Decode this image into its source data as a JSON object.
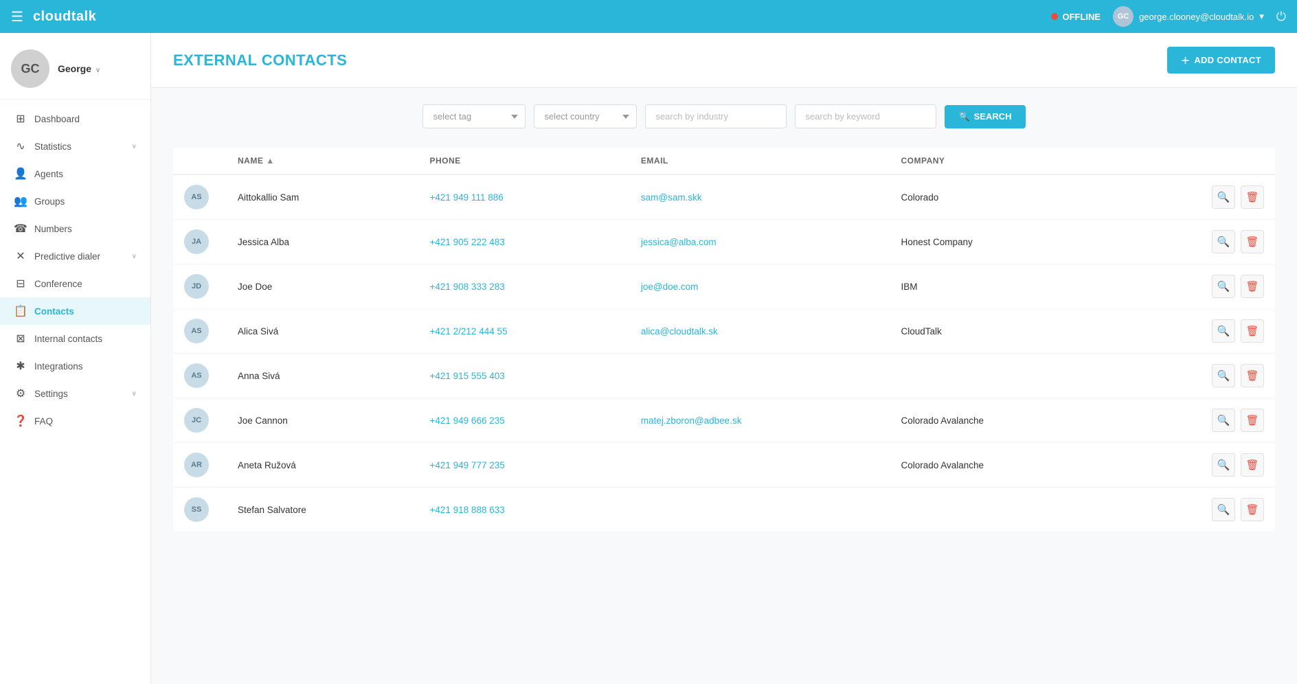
{
  "app": {
    "name": "cloudtalk",
    "menu_icon": "☰"
  },
  "topbar": {
    "status_label": "OFFLINE",
    "user_email": "george.clooney@cloudtalk.io",
    "user_initials": "GC",
    "power_icon": "⏻",
    "caret": "▾"
  },
  "sidebar": {
    "profile": {
      "initials": "GC",
      "name": "George",
      "caret": "∨"
    },
    "items": [
      {
        "id": "dashboard",
        "icon": "⊞",
        "label": "Dashboard",
        "caret": ""
      },
      {
        "id": "statistics",
        "icon": "∿",
        "label": "Statistics",
        "caret": "∨"
      },
      {
        "id": "agents",
        "icon": "👤",
        "label": "Agents",
        "caret": ""
      },
      {
        "id": "groups",
        "icon": "👥",
        "label": "Groups",
        "caret": ""
      },
      {
        "id": "numbers",
        "icon": "☎",
        "label": "Numbers",
        "caret": ""
      },
      {
        "id": "predictive-dialer",
        "icon": "✕",
        "label": "Predictive dialer",
        "caret": "∨"
      },
      {
        "id": "conference",
        "icon": "⊟",
        "label": "Conference",
        "caret": ""
      },
      {
        "id": "contacts",
        "icon": "📋",
        "label": "Contacts",
        "caret": ""
      },
      {
        "id": "internal-contacts",
        "icon": "⊠",
        "label": "Internal contacts",
        "caret": ""
      },
      {
        "id": "integrations",
        "icon": "✱",
        "label": "Integrations",
        "caret": ""
      },
      {
        "id": "settings",
        "icon": "⚙",
        "label": "Settings",
        "caret": "∨"
      },
      {
        "id": "faq",
        "icon": "❓",
        "label": "FAQ",
        "caret": ""
      }
    ]
  },
  "page": {
    "title": "EXTERNAL CONTACTS",
    "add_button": "ADD CONTACT"
  },
  "filters": {
    "tag_placeholder": "select tag",
    "country_placeholder": "select country",
    "industry_placeholder": "search by industry",
    "keyword_placeholder": "search by keyword",
    "search_button": "SEARCH"
  },
  "table": {
    "columns": [
      {
        "id": "name",
        "label": "NAME",
        "sort": true
      },
      {
        "id": "phone",
        "label": "PHONE"
      },
      {
        "id": "email",
        "label": "EMAIL"
      },
      {
        "id": "company",
        "label": "COMPANY"
      },
      {
        "id": "actions",
        "label": ""
      }
    ],
    "rows": [
      {
        "initials": "AS",
        "name": "Aittokallio Sam",
        "phone": "+421 949 111 886",
        "email": "sam@sam.skk",
        "company": "Colorado"
      },
      {
        "initials": "JA",
        "name": "Jessica Alba",
        "phone": "+421 905 222 483",
        "email": "jessica@alba.com",
        "company": "Honest Company"
      },
      {
        "initials": "JD",
        "name": "Joe Doe",
        "phone": "+421 908 333 283",
        "email": "joe@doe.com",
        "company": "IBM"
      },
      {
        "initials": "AS",
        "name": "Alica Sivá",
        "phone": "+421 2/212 444 55",
        "email": "alica@cloudtalk.sk",
        "company": "CloudTalk"
      },
      {
        "initials": "AS",
        "name": "Anna Sivá",
        "phone": "+421 915 555 403",
        "email": "",
        "company": ""
      },
      {
        "initials": "JC",
        "name": "Joe Cannon",
        "phone": "+421 949 666 235",
        "email": "matej.zboron@adbee.sk",
        "company": "Colorado Avalanche"
      },
      {
        "initials": "AR",
        "name": "Aneta Ružová",
        "phone": "+421 949 777 235",
        "email": "",
        "company": "Colorado Avalanche"
      },
      {
        "initials": "SS",
        "name": "Stefan Salvatore",
        "phone": "+421 918 888 633",
        "email": "",
        "company": ""
      }
    ]
  }
}
